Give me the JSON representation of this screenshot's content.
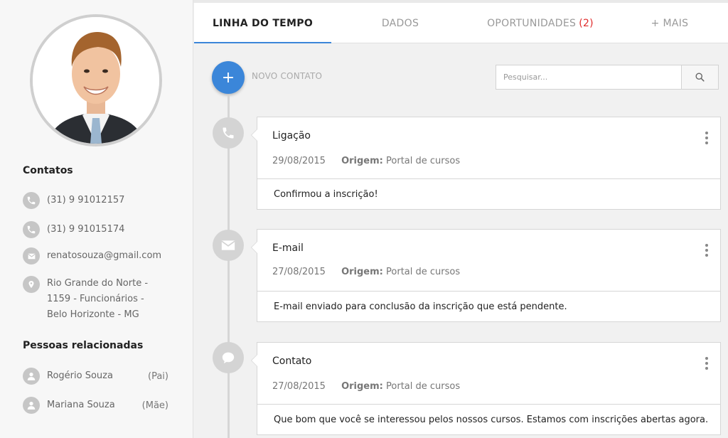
{
  "profile": {
    "avatar_icon": "person-photo"
  },
  "contacts": {
    "title": "Contatos",
    "phone1": "(31) 9 91012157",
    "phone2": "(31) 9 91015174",
    "email": "renatosouza@gmail.com",
    "address_line1": "Rio Grande do Norte -",
    "address_line2": "1159 - Funcionários -",
    "address_line3": "Belo Horizonte - MG"
  },
  "related": {
    "title": "Pessoas relacionadas",
    "people": [
      {
        "name": "Rogério Souza",
        "relation": "(Pai)"
      },
      {
        "name": "Mariana Souza",
        "relation": "(Mãe)"
      }
    ]
  },
  "tabs": [
    {
      "label": "LINHA DO TEMPO",
      "active": true
    },
    {
      "label": "DADOS"
    },
    {
      "label": "OPORTUNIDADES",
      "badge": "(2)"
    },
    {
      "label": "+ MAIS"
    }
  ],
  "toolbar": {
    "add_label": "NOVO CONTATO",
    "add_symbol": "+",
    "search_placeholder": "Pesquisar..."
  },
  "timeline": [
    {
      "icon": "phone-icon",
      "title": "Ligação",
      "date": "29/08/2015",
      "origin_label": "Origem:",
      "origin": "Portal de cursos",
      "note": "Confirmou a inscrição!"
    },
    {
      "icon": "mail-icon",
      "title": "E-mail",
      "date": "27/08/2015",
      "origin_label": "Origem:",
      "origin": "Portal de cursos",
      "note": "E-mail enviado para conclusão da inscrição que está pendente."
    },
    {
      "icon": "chat-icon",
      "title": "Contato",
      "date": "27/08/2015",
      "origin_label": "Origem:",
      "origin": "Portal de cursos",
      "note": "Que bom que você se interessou pelos nossos cursos. Estamos com inscrições abertas agora."
    }
  ],
  "colors": {
    "accent": "#3b86d9",
    "badge": "#e02b2b",
    "icon_gray": "#c6c6c6"
  }
}
